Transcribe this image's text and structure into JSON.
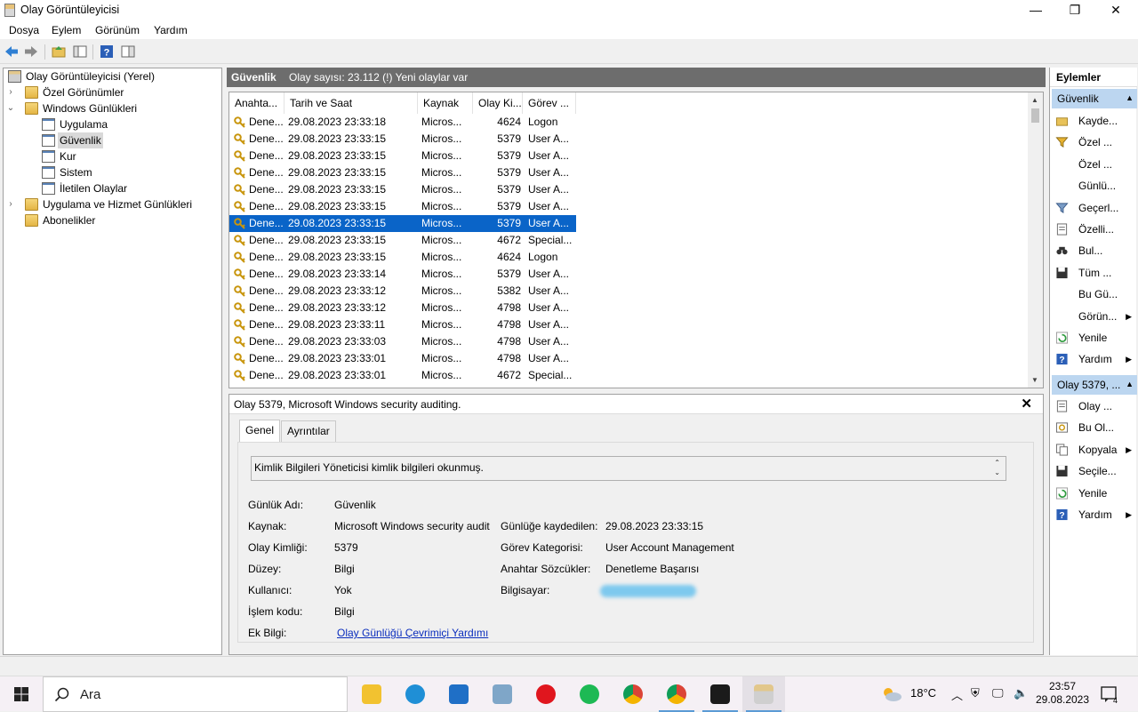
{
  "window": {
    "title": "Olay Görüntüleyicisi",
    "minimize": "—",
    "maximize": "❐",
    "close": "✕"
  },
  "menu": [
    "Dosya",
    "Eylem",
    "Görünüm",
    "Yardım"
  ],
  "tree": {
    "root": "Olay Görüntüleyicisi (Yerel)",
    "custom_views": "Özel Görünümler",
    "windows_logs": "Windows Günlükleri",
    "logs": [
      "Uygulama",
      "Güvenlik",
      "Kur",
      "Sistem",
      "İletilen Olaylar"
    ],
    "app_service_logs": "Uygulama ve Hizmet Günlükleri",
    "subscriptions": "Abonelikler"
  },
  "center": {
    "title": "Güvenlik",
    "summary": "Olay sayısı: 23.112 (!) Yeni olaylar var",
    "columns": [
      "Anahta...",
      "Tarih ve Saat",
      "Kaynak",
      "Olay Ki...",
      "Görev ..."
    ],
    "rows": [
      [
        "Dene...",
        "29.08.2023 23:33:18",
        "Micros...",
        "4624",
        "Logon"
      ],
      [
        "Dene...",
        "29.08.2023 23:33:15",
        "Micros...",
        "5379",
        "User A..."
      ],
      [
        "Dene...",
        "29.08.2023 23:33:15",
        "Micros...",
        "5379",
        "User A..."
      ],
      [
        "Dene...",
        "29.08.2023 23:33:15",
        "Micros...",
        "5379",
        "User A..."
      ],
      [
        "Dene...",
        "29.08.2023 23:33:15",
        "Micros...",
        "5379",
        "User A..."
      ],
      [
        "Dene...",
        "29.08.2023 23:33:15",
        "Micros...",
        "5379",
        "User A..."
      ],
      [
        "Dene...",
        "29.08.2023 23:33:15",
        "Micros...",
        "5379",
        "User A..."
      ],
      [
        "Dene...",
        "29.08.2023 23:33:15",
        "Micros...",
        "4672",
        "Special..."
      ],
      [
        "Dene...",
        "29.08.2023 23:33:15",
        "Micros...",
        "4624",
        "Logon"
      ],
      [
        "Dene...",
        "29.08.2023 23:33:14",
        "Micros...",
        "5379",
        "User A..."
      ],
      [
        "Dene...",
        "29.08.2023 23:33:12",
        "Micros...",
        "5382",
        "User A..."
      ],
      [
        "Dene...",
        "29.08.2023 23:33:12",
        "Micros...",
        "4798",
        "User A..."
      ],
      [
        "Dene...",
        "29.08.2023 23:33:11",
        "Micros...",
        "4798",
        "User A..."
      ],
      [
        "Dene...",
        "29.08.2023 23:33:03",
        "Micros...",
        "4798",
        "User A..."
      ],
      [
        "Dene...",
        "29.08.2023 23:33:01",
        "Micros...",
        "4798",
        "User A..."
      ],
      [
        "Dene...",
        "29.08.2023 23:33:01",
        "Micros...",
        "4672",
        "Special..."
      ]
    ],
    "selected_row": 6
  },
  "details": {
    "title": "Olay 5379, Microsoft Windows security auditing.",
    "close": "✕",
    "tabs": [
      "Genel",
      "Ayrıntılar"
    ],
    "description": "Kimlik Bilgileri Yöneticisi kimlik bilgileri okunmuş.",
    "fields": {
      "log_name_label": "Günlük Adı:",
      "log_name": "Güvenlik",
      "source_label": "Kaynak:",
      "source": "Microsoft Windows security audit",
      "logged_label": "Günlüğe kaydedilen:",
      "logged": "29.08.2023 23:33:15",
      "event_id_label": "Olay Kimliği:",
      "event_id": "5379",
      "task_category_label": "Görev Kategorisi:",
      "task_category": "User Account Management",
      "level_label": "Düzey:",
      "level": "Bilgi",
      "keywords_label": "Anahtar Sözcükler:",
      "keywords": "Denetleme Başarısı",
      "user_label": "Kullanıcı:",
      "user": "Yok",
      "computer_label": "Bilgisayar:",
      "opcode_label": "İşlem kodu:",
      "opcode": "Bilgi",
      "more_info_label": "Ek Bilgi:",
      "more_info_link": "Olay Günlüğü Çevrimiçi Yardımı"
    }
  },
  "actions": {
    "header": "Eylemler",
    "section1": "Güvenlik",
    "section1_items": [
      {
        "label": "Kayde...",
        "icon": "open-log-icon",
        "sub": false
      },
      {
        "label": "Özel ...",
        "icon": "filter-icon",
        "sub": false
      },
      {
        "label": "Özel ...",
        "icon": "",
        "sub": false
      },
      {
        "label": "Günlü...",
        "icon": "",
        "sub": false
      },
      {
        "label": "Geçerl...",
        "icon": "filter-current-icon",
        "sub": false
      },
      {
        "label": "Özelli...",
        "icon": "properties-icon",
        "sub": false
      },
      {
        "label": "Bul...",
        "icon": "find-icon",
        "sub": false
      },
      {
        "label": "Tüm ...",
        "icon": "save-icon",
        "sub": false
      },
      {
        "label": "Bu Gü...",
        "icon": "",
        "sub": false
      },
      {
        "label": "Görün...",
        "icon": "",
        "sub": true
      },
      {
        "label": "Yenile",
        "icon": "refresh-icon",
        "sub": false
      },
      {
        "label": "Yardım",
        "icon": "help-icon",
        "sub": true
      }
    ],
    "section2": "Olay 5379, ...",
    "section2_items": [
      {
        "label": "Olay ...",
        "icon": "event-properties-icon",
        "sub": false
      },
      {
        "label": "Bu Ol...",
        "icon": "attach-task-icon",
        "sub": false
      },
      {
        "label": "Kopyala",
        "icon": "copy-icon",
        "sub": true
      },
      {
        "label": "Seçile...",
        "icon": "save-icon",
        "sub": false
      },
      {
        "label": "Yenile",
        "icon": "refresh-icon",
        "sub": false
      },
      {
        "label": "Yardım",
        "icon": "help-icon",
        "sub": true
      }
    ]
  },
  "taskbar": {
    "search_placeholder": "Ara",
    "weather": "18°C",
    "time": "23:57",
    "date": "29.08.2023",
    "notifications": "4"
  },
  "colors": {
    "selection": "#0a64c8",
    "header_gray": "#6d6d6d",
    "action_section": "#bcd6f0"
  }
}
